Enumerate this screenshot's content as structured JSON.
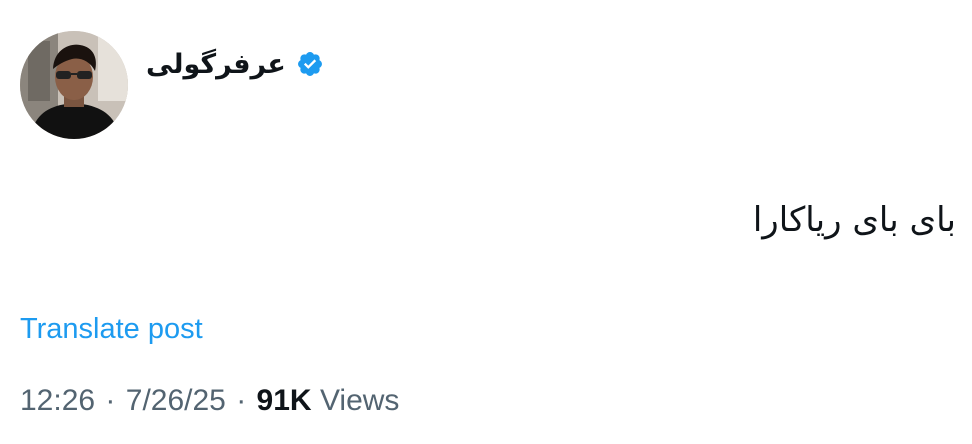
{
  "post": {
    "author": {
      "display_name": "عرفرگولی",
      "verified": true,
      "verified_icon": "verified-badge-icon",
      "accent_color": "#1d9bf0"
    },
    "text": "بای بای ریاکارا",
    "translate_label": "Translate post",
    "meta": {
      "time": "12:26",
      "separator": "·",
      "date": "7/26/25",
      "views_count": "91K",
      "views_label": "Views"
    }
  }
}
